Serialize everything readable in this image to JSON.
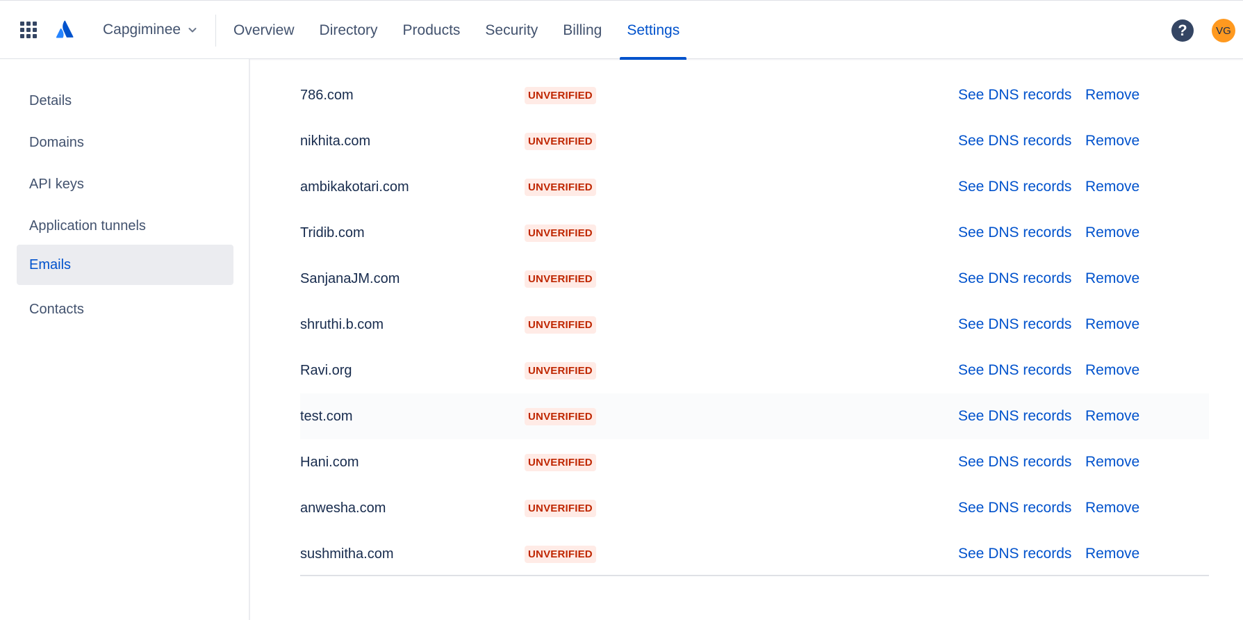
{
  "header": {
    "org_name": "Capgiminee",
    "tabs": [
      {
        "label": "Overview"
      },
      {
        "label": "Directory"
      },
      {
        "label": "Products"
      },
      {
        "label": "Security"
      },
      {
        "label": "Billing"
      },
      {
        "label": "Settings",
        "active": true
      }
    ],
    "help_label": "?",
    "avatar_initials": "VG"
  },
  "sidebar": {
    "items": [
      {
        "label": "Details"
      },
      {
        "label": "Domains"
      },
      {
        "label": "API keys"
      },
      {
        "label": "Application tunnels"
      },
      {
        "label": "Emails",
        "active": true
      },
      {
        "label": "Contacts"
      }
    ]
  },
  "domains": {
    "status_label": "UNVERIFIED",
    "dns_link_label": "See DNS records",
    "remove_label": "Remove",
    "rows": [
      {
        "name": "786.com"
      },
      {
        "name": "nikhita.com"
      },
      {
        "name": "ambikakotari.com"
      },
      {
        "name": "Tridib.com"
      },
      {
        "name": "SanjanaJM.com"
      },
      {
        "name": "shruthi.b.com"
      },
      {
        "name": "Ravi.org"
      },
      {
        "name": "test.com"
      },
      {
        "name": "Hani.com"
      },
      {
        "name": "anwesha.com"
      },
      {
        "name": "sushmitha.com"
      }
    ]
  },
  "colors": {
    "accent": "#0052cc",
    "badge_bg": "#ffebe6",
    "badge_text": "#bf2600",
    "avatar": "#ff991f"
  }
}
